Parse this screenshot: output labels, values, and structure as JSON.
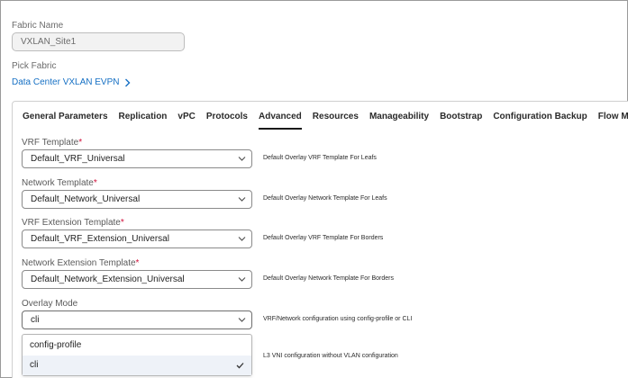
{
  "fabric": {
    "name_label": "Fabric Name",
    "name_value": "VXLAN_Site1",
    "pick_label": "Pick Fabric",
    "pick_value": "Data Center VXLAN EVPN"
  },
  "tabs": [
    {
      "label": "General Parameters"
    },
    {
      "label": "Replication"
    },
    {
      "label": "vPC"
    },
    {
      "label": "Protocols"
    },
    {
      "label": "Advanced",
      "active": true
    },
    {
      "label": "Resources"
    },
    {
      "label": "Manageability"
    },
    {
      "label": "Bootstrap"
    },
    {
      "label": "Configuration Backup"
    },
    {
      "label": "Flow Monitor"
    }
  ],
  "fields": {
    "vrf_template": {
      "label": "VRF Template",
      "required": "*",
      "value": "Default_VRF_Universal",
      "help": "Default Overlay VRF Template For Leafs"
    },
    "network_template": {
      "label": "Network Template",
      "required": "*",
      "value": "Default_Network_Universal",
      "help": "Default Overlay Network Template For Leafs"
    },
    "vrf_extension_template": {
      "label": "VRF Extension Template",
      "required": "*",
      "value": "Default_VRF_Extension_Universal",
      "help": "Default Overlay VRF Template For Borders"
    },
    "network_extension_template": {
      "label": "Network Extension Template",
      "required": "*",
      "value": "Default_Network_Extension_Universal",
      "help": "Default Overlay Network Template For Borders"
    },
    "overlay_mode": {
      "label": "Overlay Mode",
      "value": "cli",
      "help": "VRF/Network configuration using config-profile or CLI"
    }
  },
  "overlay_dropdown": {
    "options": [
      "config-profile",
      "cli"
    ],
    "selected": "cli"
  },
  "next_help": "L3 VNI configuration without VLAN configuration",
  "icons": {
    "chevron": "chevron-down-icon",
    "link_arrow": "chevron-right-icon",
    "check": "check-icon"
  }
}
